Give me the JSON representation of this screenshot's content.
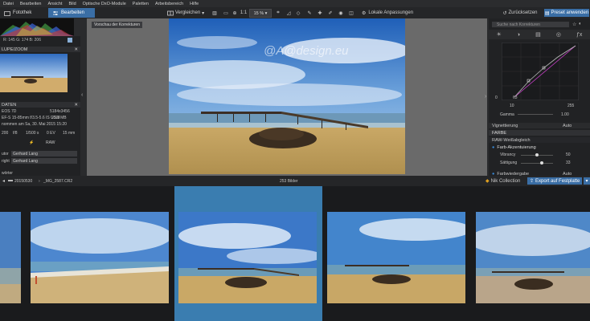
{
  "menu": [
    "Datei",
    "Bearbeiten",
    "Ansicht",
    "Bild",
    "Optische DxO-Module",
    "Paletten",
    "Arbeitsbereich",
    "Hilfe"
  ],
  "tabs": {
    "fotothek": "Fotothek",
    "bearbeiten": "Bearbeiten"
  },
  "toolbar": {
    "vergleichen": "Vergleichen",
    "ratio": "1:1",
    "zoom": "15 %",
    "lokale": "Lokale Anpassungen",
    "zuruecksetzen": "Zurücksetzen",
    "preset": "Preset anwenden"
  },
  "left": {
    "histo_vals": "R: 145   G: 174   B: 206",
    "loupe_header": "LUPE/ZOOM",
    "info_header": "DATEN",
    "cam": "EOS 7D",
    "dims": "5184x3456",
    "lens": "EF-S 15-85mm f/3.5-5.6 IS USM",
    "size": "23.3 MB",
    "date": "nommen am Sa, 30. Mai 2015 15:20",
    "exif": [
      "200",
      "f/8",
      "1/500 s",
      "0 EV",
      "15 mm"
    ],
    "raw": "RAW",
    "author_label": "utor",
    "author": "Gerhard Lang",
    "copy_label": "right",
    "copy": "Gerhard Lang",
    "kw_label": "wörter"
  },
  "center": {
    "preview_label": "Vorschau der Korrekturen",
    "watermark": "@A@design.eu"
  },
  "right": {
    "search_placeholder": "Suche nach Korrekturen",
    "curve_in": "0",
    "curve_in2": "63",
    "curve_out": "10",
    "curve_out2": "255",
    "gamma_label": "Gamma",
    "gamma_val": "1.00",
    "vignette_label": "Vignettierung",
    "vignette_mode": "Auto",
    "farbe_header": "FARBE",
    "weiss_label": "RAW-Weißabgleich",
    "farb_label": "Farb-Akzentuierung",
    "vibrancy_label": "Vibrancy",
    "vibrancy_val": "50",
    "saett_label": "Sättigung",
    "saett_val": "33",
    "farbwied_label": "Farbwiedergabe",
    "farbwied_mode": "Auto"
  },
  "strip": {
    "path": "20150530",
    "file": "_MG_2587.CR2",
    "count": "253 Bilder",
    "nik": "Nik Collection",
    "export": "Export auf Festplatte"
  }
}
